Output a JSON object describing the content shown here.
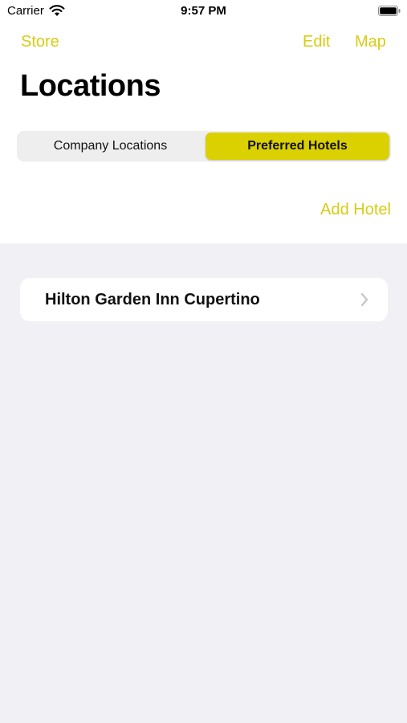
{
  "status_bar": {
    "carrier": "Carrier",
    "time": "9:57 PM",
    "icons": [
      "wifi-icon",
      "battery-icon"
    ]
  },
  "nav": {
    "left_button": "Store",
    "right_buttons": [
      "Edit",
      "Map"
    ]
  },
  "title": "Locations",
  "segmented_control": {
    "segments": [
      "Company Locations",
      "Preferred Hotels"
    ],
    "selected": "Preferred Hotels"
  },
  "actions": {
    "add_hotel": "Add Hotel"
  },
  "hotels": [
    {
      "name": "Hilton Garden Inn Cupertino"
    }
  ],
  "colors": {
    "accent": "#d7cc14",
    "selected_segment": "#dbd000",
    "background": "#f0f0f5"
  }
}
